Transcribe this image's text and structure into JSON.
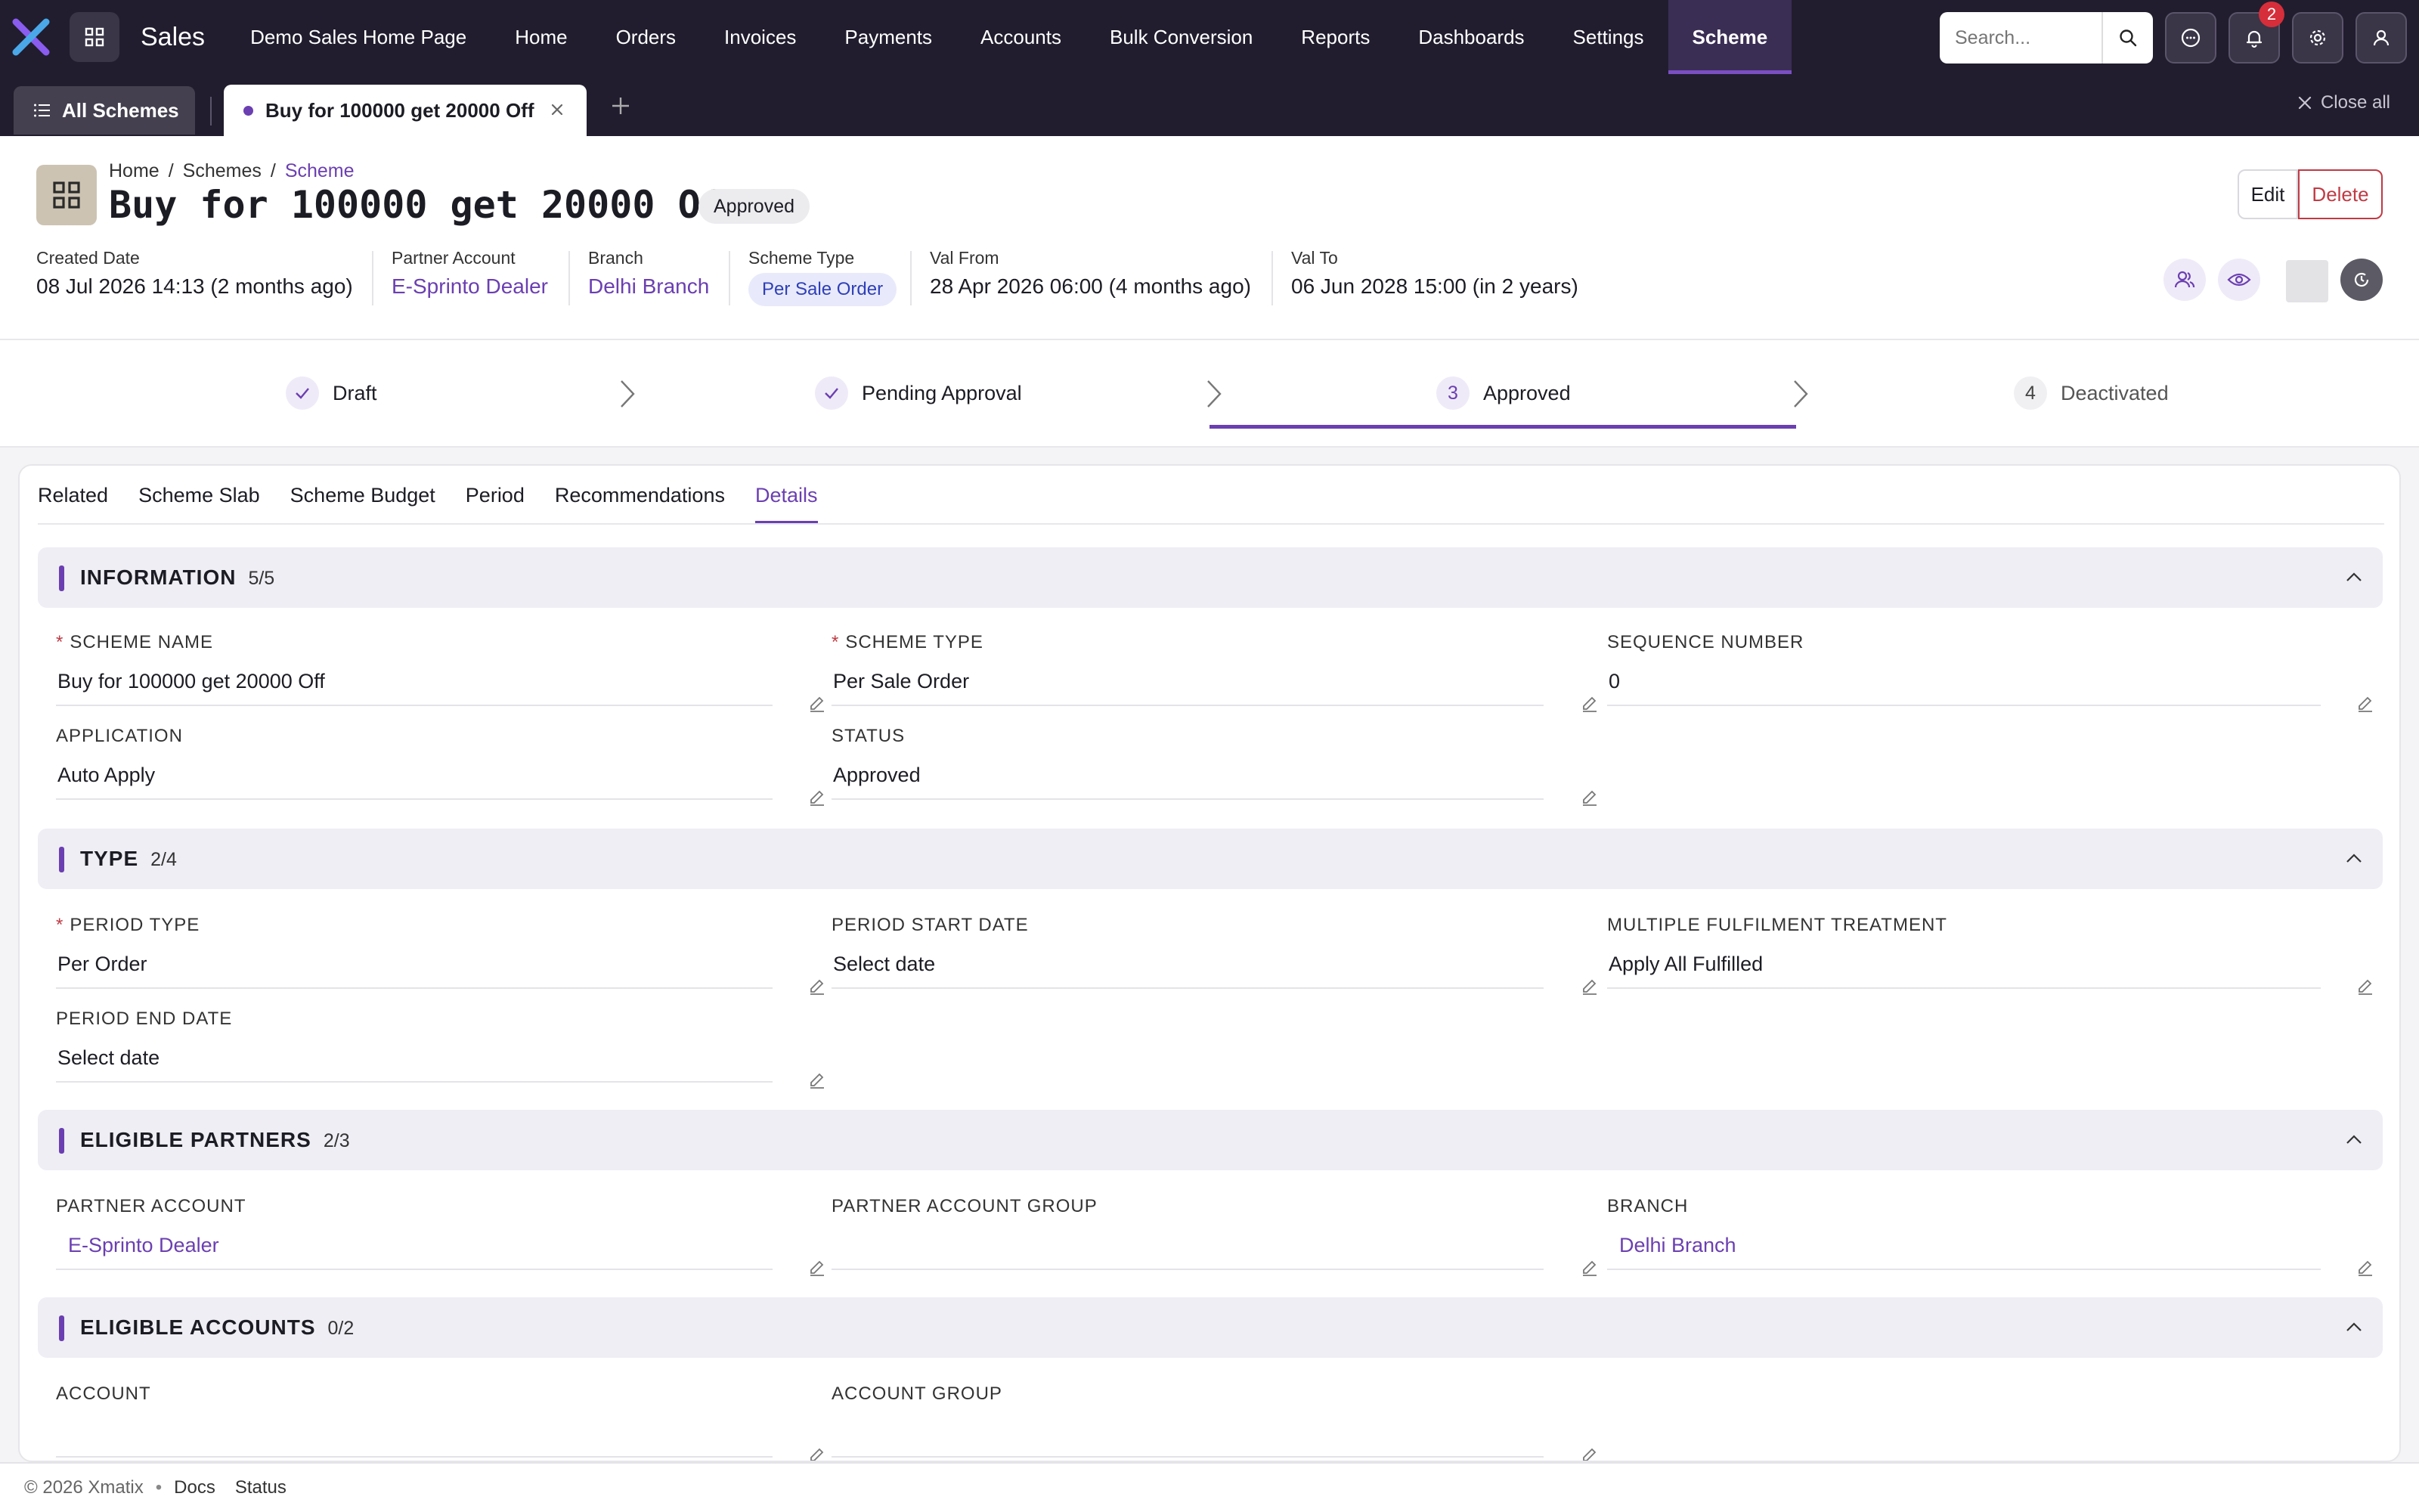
{
  "app": {
    "name": "Sales"
  },
  "nav": {
    "items": [
      "Demo Sales Home Page",
      "Home",
      "Orders",
      "Invoices",
      "Payments",
      "Accounts",
      "Bulk Conversion",
      "Reports",
      "Dashboards",
      "Settings",
      "Scheme"
    ],
    "active": "Scheme"
  },
  "search": {
    "placeholder": "Search..."
  },
  "notifications": {
    "count": "2"
  },
  "tabs": {
    "all_label": "All Schemes",
    "open_tab": "Buy for 100000 get 20000 Off",
    "close_all": "Close all"
  },
  "record": {
    "breadcrumb": [
      "Home",
      "Schemes",
      "Scheme"
    ],
    "title": "Buy for 100000 get 20000 Off",
    "status_badge": "Approved",
    "edit_label": "Edit",
    "delete_label": "Delete",
    "meta": {
      "created_label": "Created Date",
      "created_value": "08 Jul 2026 14:13 (2 months ago)",
      "partner_label": "Partner Account",
      "partner_value": "E-Sprinto Dealer",
      "branch_label": "Branch",
      "branch_value": "Delhi Branch",
      "scheme_type_label": "Scheme Type",
      "scheme_type_value": "Per Sale Order",
      "val_from_label": "Val From",
      "val_from_value": "28 Apr 2026 06:00 (4 months ago)",
      "val_to_label": "Val To",
      "val_to_value": "06 Jun 2028 15:00 (in 2 years)"
    }
  },
  "steps": [
    {
      "num": "",
      "label": "Draft",
      "state": "done"
    },
    {
      "num": "",
      "label": "Pending Approval",
      "state": "done"
    },
    {
      "num": "3",
      "label": "Approved",
      "state": "current"
    },
    {
      "num": "4",
      "label": "Deactivated",
      "state": "todo"
    }
  ],
  "subtabs": [
    "Related",
    "Scheme Slab",
    "Scheme Budget",
    "Period",
    "Recommendations",
    "Details"
  ],
  "subtab_active": "Details",
  "sections": {
    "information": {
      "title": "INFORMATION",
      "count": "5/5",
      "scheme_name_label": "SCHEME NAME",
      "scheme_name_value": "Buy for 100000 get 20000 Off",
      "scheme_type_label": "SCHEME TYPE",
      "scheme_type_value": "Per Sale Order",
      "sequence_label": "SEQUENCE NUMBER",
      "sequence_value": "0",
      "application_label": "APPLICATION",
      "application_value": "Auto Apply",
      "status_label": "STATUS",
      "status_value": "Approved"
    },
    "type": {
      "title": "TYPE",
      "count": "2/4",
      "period_type_label": "PERIOD TYPE",
      "period_type_value": "Per Order",
      "period_start_label": "PERIOD START DATE",
      "period_start_value": "Select date",
      "multi_label": "MULTIPLE FULFILMENT TREATMENT",
      "multi_value": "Apply All Fulfilled",
      "period_end_label": "PERIOD END DATE",
      "period_end_value": "Select date"
    },
    "partners": {
      "title": "ELIGIBLE PARTNERS",
      "count": "2/3",
      "partner_label": "PARTNER ACCOUNT",
      "partner_value": "E-Sprinto Dealer",
      "group_label": "PARTNER ACCOUNT GROUP",
      "group_value": "",
      "branch_label": "BRANCH",
      "branch_value": "Delhi Branch"
    },
    "accounts": {
      "title": "ELIGIBLE ACCOUNTS",
      "count": "0/2",
      "account_label": "ACCOUNT",
      "account_value": "",
      "group_label": "ACCOUNT GROUP",
      "group_value": ""
    }
  },
  "footer": {
    "copyright": "© 2026 Xmatix",
    "docs": "Docs",
    "status": "Status"
  },
  "colors": {
    "accent": "#6b3fb1",
    "topbar": "#211d2e",
    "danger": "#c03a44",
    "section_bg": "#efeef4"
  }
}
